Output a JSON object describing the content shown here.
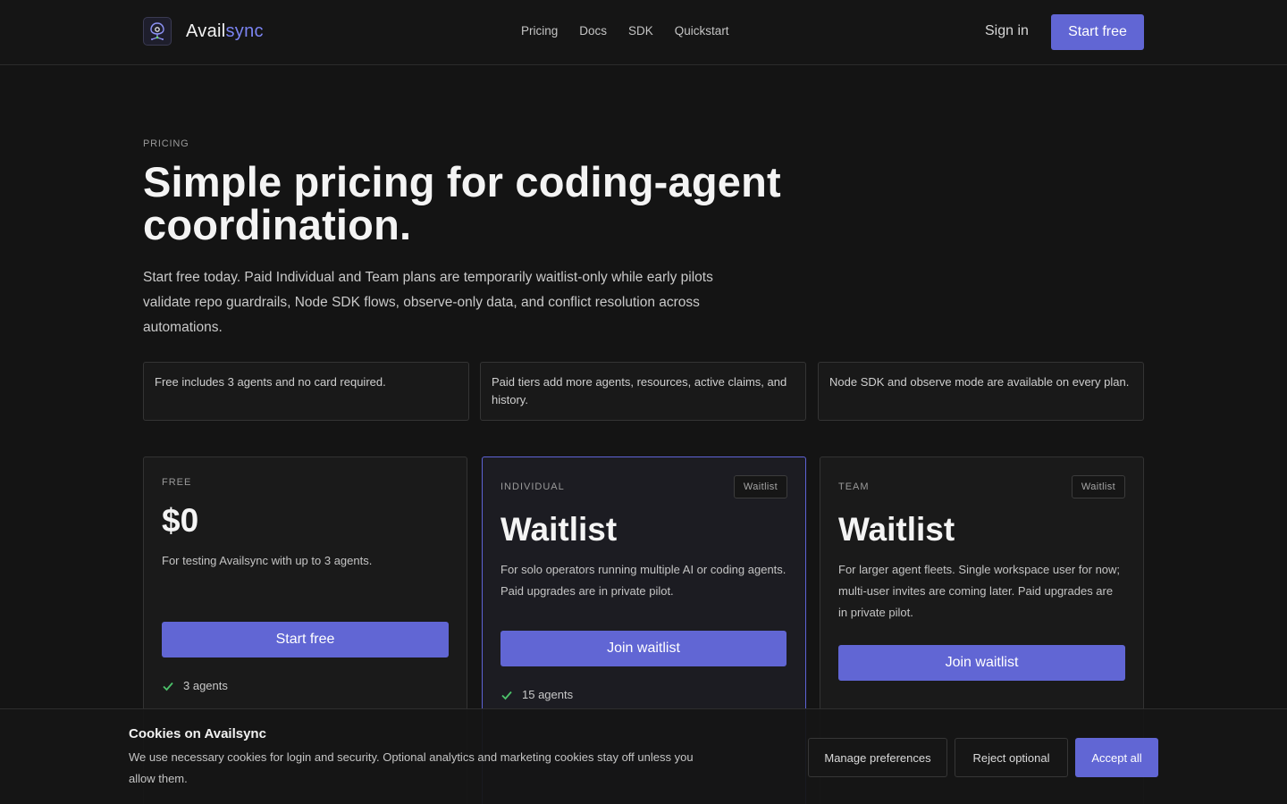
{
  "brand": {
    "name_part1": "Avail",
    "name_part2": "sync",
    "accent": "#6166d4",
    "accent_text": "#7b84f2"
  },
  "nav": {
    "items": [
      "Pricing",
      "Docs",
      "SDK",
      "Quickstart"
    ],
    "sign_in": "Sign in",
    "start_free": "Start free"
  },
  "hero": {
    "eyebrow": "PRICING",
    "title": "Simple pricing for coding-agent coordination.",
    "subtitle": "Start free today. Paid Individual and Team plans are temporarily waitlist-only while early pilots validate repo guardrails, Node SDK flows, observe-only data, and conflict resolution across automations."
  },
  "info_boxes": [
    "Free includes 3 agents and no card required.",
    "Paid tiers add more agents, resources, active claims, and history.",
    "Node SDK and observe mode are available on every plan."
  ],
  "plans": [
    {
      "tier": "FREE",
      "price": "$0",
      "description": "For testing Availsync with up to 3 agents.",
      "cta": "Start free",
      "first_feature": "3 agents"
    },
    {
      "tier": "INDIVIDUAL",
      "badge": "Waitlist",
      "price": "Waitlist",
      "description": "For solo operators running multiple AI or coding agents. Paid upgrades are in private pilot.",
      "cta": "Join waitlist",
      "first_feature": "15 agents"
    },
    {
      "tier": "TEAM",
      "badge": "Waitlist",
      "price": "Waitlist",
      "description": "For larger agent fleets. Single workspace user for now; multi-user invites are coming later. Paid upgrades are in private pilot.",
      "cta": "Join waitlist"
    }
  ],
  "cookie": {
    "title": "Cookies on Availsync",
    "text": "We use necessary cookies for login and security. Optional analytics and marketing cookies stay off unless you allow them.",
    "manage": "Manage preferences",
    "reject": "Reject optional",
    "accept": "Accept all"
  },
  "icons": {
    "logo": "robot-node-icon",
    "check": "check-icon"
  }
}
